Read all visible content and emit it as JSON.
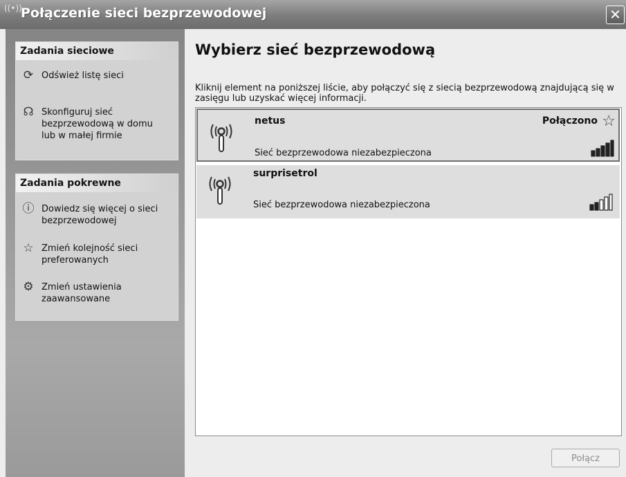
{
  "window": {
    "title": "Połączenie sieci bezprzewodowej",
    "title_icon": "((•))",
    "close_label": "✕"
  },
  "sidebar": {
    "network_tasks": {
      "heading": "Zadania sieciowe",
      "items": [
        {
          "icon": "refresh-icon",
          "label": "Odśwież listę sieci"
        },
        {
          "icon": "setup-wizard-icon",
          "label": "Skonfiguruj sieć bezprzewodową w domu lub w małej firmie"
        }
      ]
    },
    "related_tasks": {
      "heading": "Zadania pokrewne",
      "items": [
        {
          "icon": "info-icon",
          "label": "Dowiedz się więcej o sieci bezprzewodowej"
        },
        {
          "icon": "star-icon",
          "label": "Zmień kolejność sieci preferowanych"
        },
        {
          "icon": "settings-icon",
          "label": "Zmień ustawienia zaawansowane"
        }
      ]
    }
  },
  "main": {
    "heading": "Wybierz sieć bezprzewodową",
    "intro": "Kliknij element na poniższej liście, aby połączyć się z siecią bezprzewodową znajdującą się w zasięgu lub uzyskać więcej informacji.",
    "networks": [
      {
        "name": "netus",
        "description": "Sieć bezprzewodowa niezabezpieczona",
        "status": "Połączono",
        "signal_bars": 5,
        "selected": true
      },
      {
        "name": "surprisetrol",
        "description": "Sieć bezprzewodowa niezabezpieczona",
        "status": "",
        "signal_bars": 2,
        "selected": false
      }
    ],
    "connect_button": "Połącz"
  }
}
